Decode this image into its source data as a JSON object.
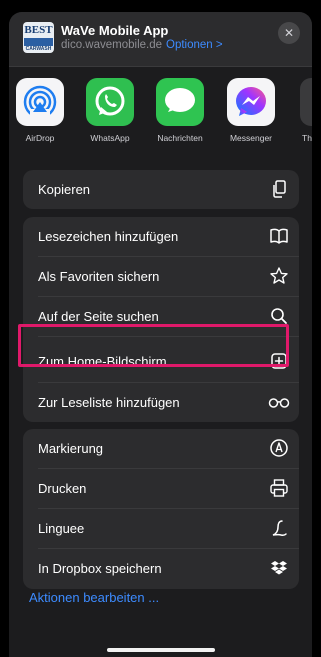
{
  "header": {
    "logo_text_top": "BEST",
    "logo_text_bottom": "CARWASH",
    "title": "WaVe Mobile App",
    "domain": "dico.wavemobile.de",
    "options_label": "Optionen >",
    "close_symbol": "✕"
  },
  "apps": [
    {
      "label": "AirDrop",
      "icon": "airdrop-icon"
    },
    {
      "label": "WhatsApp",
      "icon": "whatsapp-icon"
    },
    {
      "label": "Nachrichten",
      "icon": "messages-icon"
    },
    {
      "label": "Messenger",
      "icon": "messenger-icon"
    },
    {
      "label": "Th",
      "icon": "app-icon-partial"
    }
  ],
  "actions": {
    "copy": "Kopieren",
    "add_bookmark": "Lesezeichen hinzufügen",
    "add_favorite": "Als Favoriten sichern",
    "find_on_page": "Auf der Seite suchen",
    "add_home_screen": "Zum Home-Bildschirm",
    "add_reading_list": "Zur Leseliste hinzufügen",
    "markup": "Markierung",
    "print": "Drucken",
    "linguee": "Linguee",
    "save_dropbox": "In Dropbox speichern",
    "edit_actions": "Aktionen bearbeiten ..."
  },
  "colors": {
    "accent_blue": "#3d8bff",
    "highlight_pink": "#e0196a",
    "sheet_bg": "#1c1c1e",
    "row_bg": "#2c2c2e"
  }
}
